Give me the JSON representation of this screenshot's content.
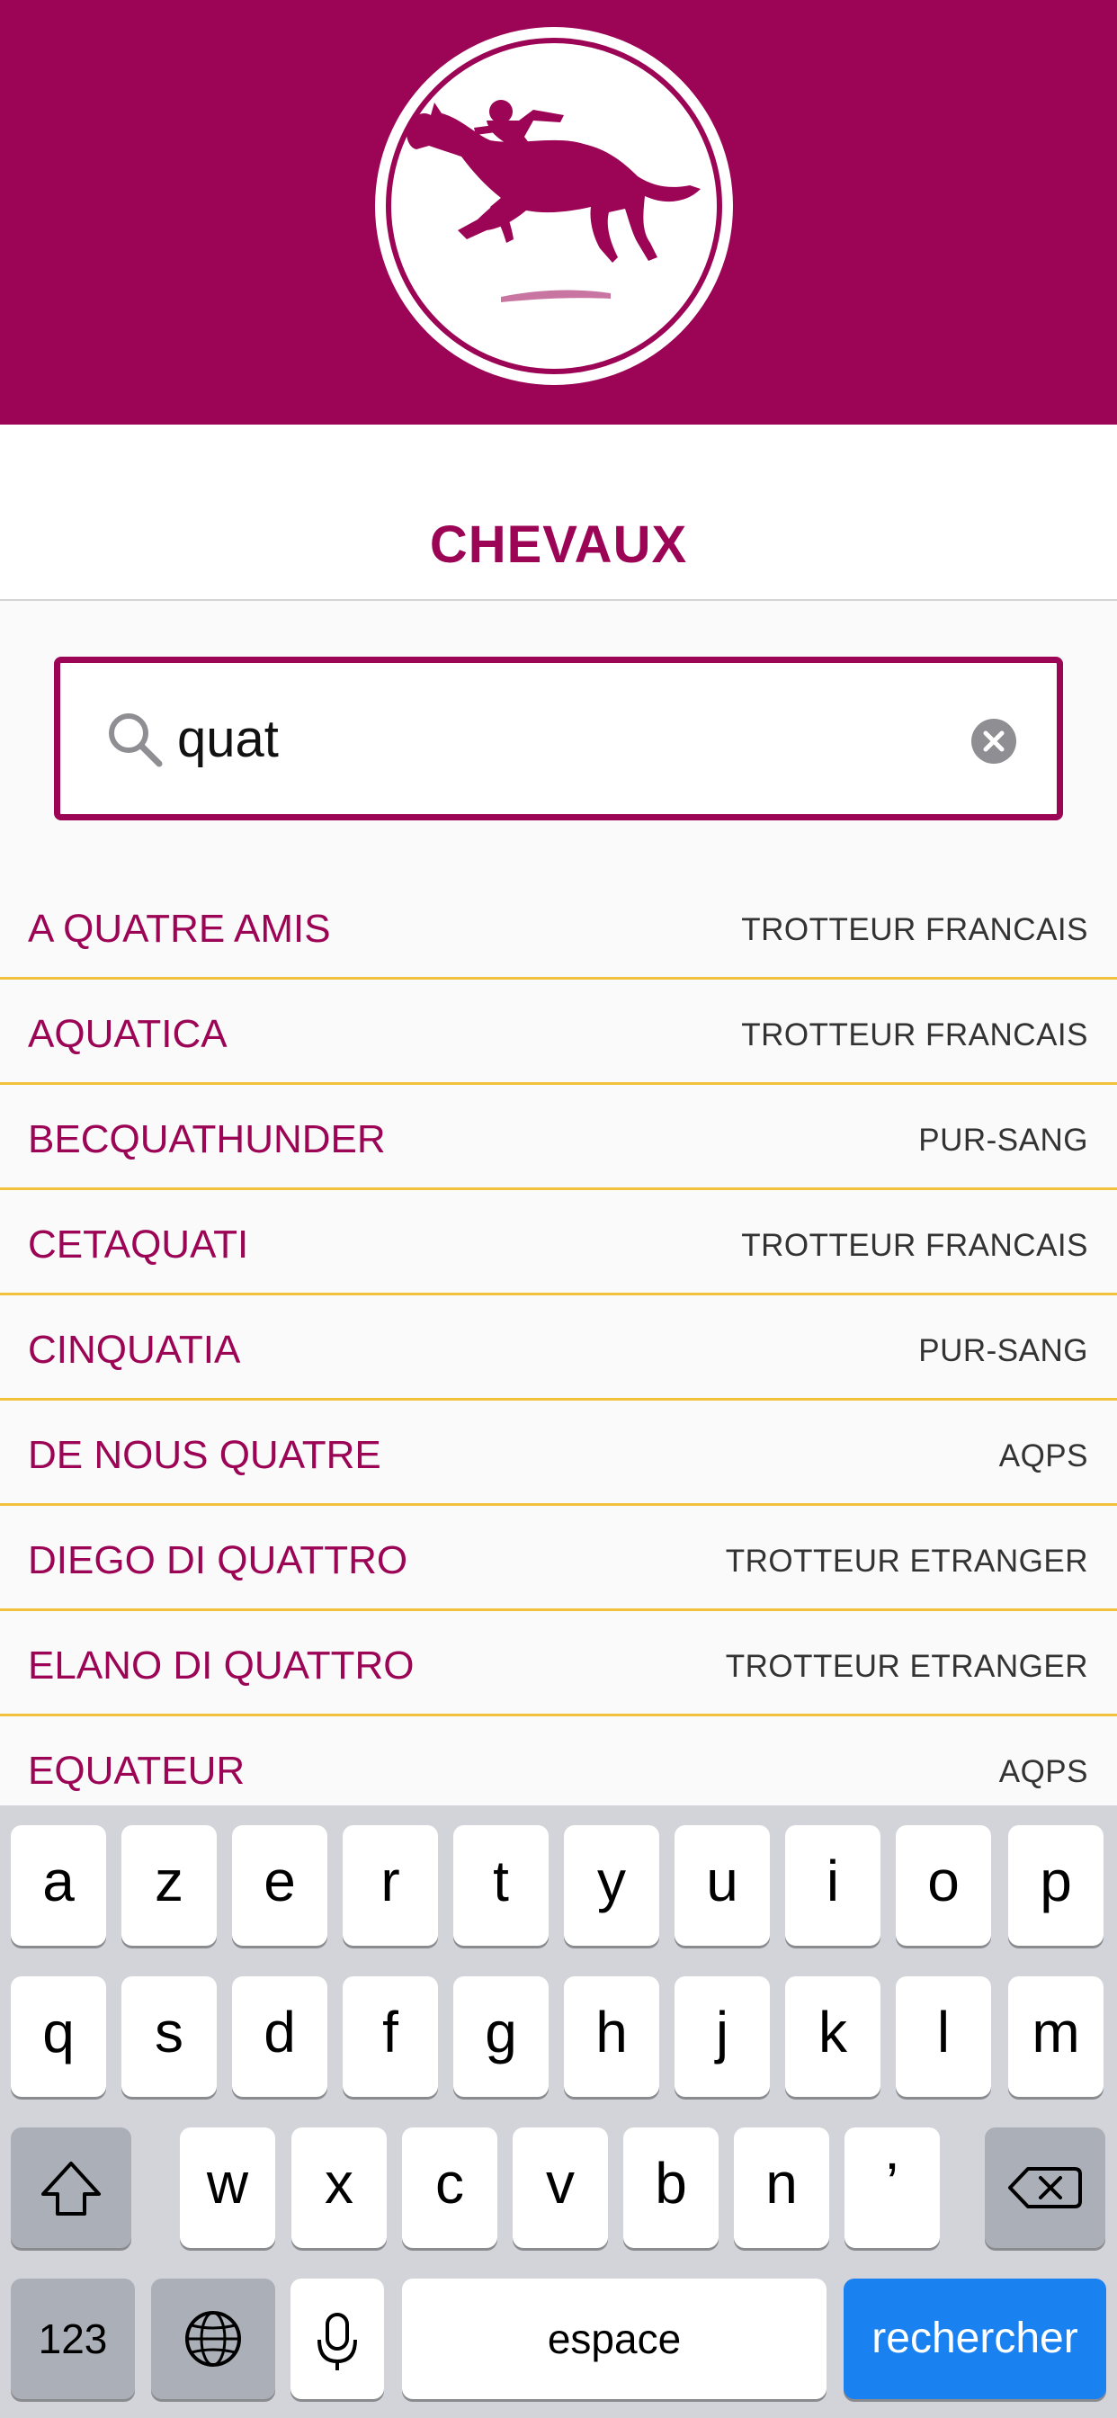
{
  "header": {
    "logo_icon": "horse-jockey-logo"
  },
  "page": {
    "title": "CHEVAUX"
  },
  "search": {
    "value": "quat",
    "icon": "search-icon",
    "clear_icon": "clear-icon"
  },
  "results": [
    {
      "name": "A QUATRE AMIS",
      "type": "TROTTEUR FRANCAIS"
    },
    {
      "name": "AQUATICA",
      "type": "TROTTEUR FRANCAIS"
    },
    {
      "name": "BECQUATHUNDER",
      "type": "PUR-SANG"
    },
    {
      "name": "CETAQUATI",
      "type": "TROTTEUR FRANCAIS"
    },
    {
      "name": "CINQUATIA",
      "type": "PUR-SANG"
    },
    {
      "name": "DE NOUS QUATRE",
      "type": "AQPS"
    },
    {
      "name": "DIEGO DI QUATTRO",
      "type": "TROTTEUR ETRANGER"
    },
    {
      "name": "ELANO DI QUATTRO",
      "type": "TROTTEUR ETRANGER"
    },
    {
      "name": "EQUATEUR",
      "type": "AQPS"
    }
  ],
  "keyboard": {
    "row1": [
      "a",
      "z",
      "e",
      "r",
      "t",
      "y",
      "u",
      "i",
      "o",
      "p"
    ],
    "row2": [
      "q",
      "s",
      "d",
      "f",
      "g",
      "h",
      "j",
      "k",
      "l",
      "m"
    ],
    "row3": [
      "w",
      "x",
      "c",
      "v",
      "b",
      "n",
      "’"
    ],
    "numbers_label": "123",
    "space_label": "espace",
    "search_label": "rechercher",
    "shift_icon": "shift-icon",
    "backspace_icon": "backspace-icon",
    "globe_icon": "globe-icon",
    "mic_icon": "microphone-icon"
  },
  "colors": {
    "brand": "#9c0455",
    "divider": "#f2c23c",
    "keyboard_action": "#1a81f1"
  }
}
